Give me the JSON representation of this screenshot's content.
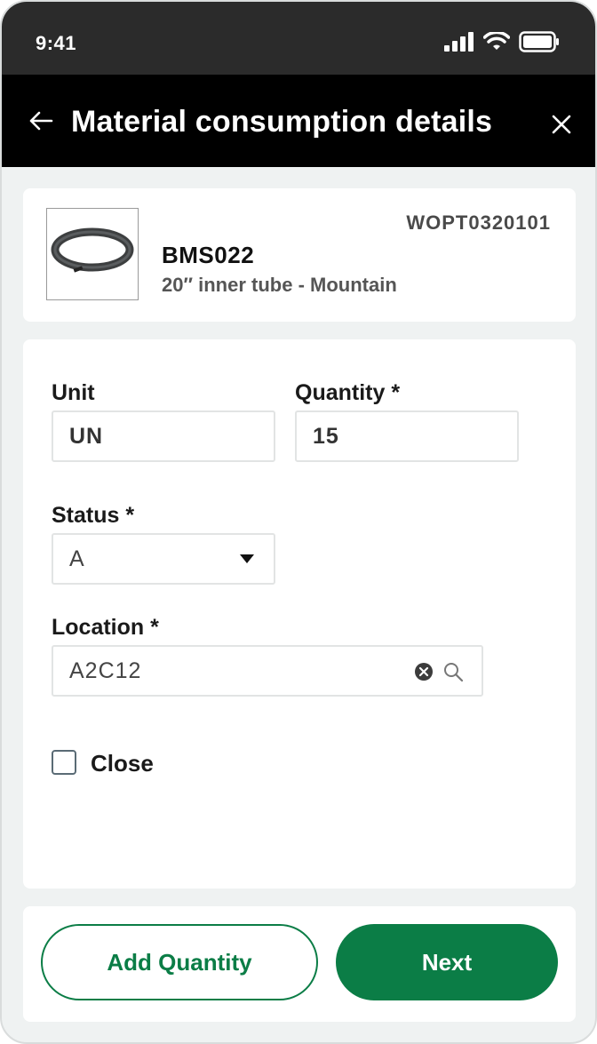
{
  "status_bar": {
    "time": "9:41"
  },
  "header": {
    "title": "Material consumption details"
  },
  "item": {
    "order_code": "WOPT0320101",
    "code": "BMS022",
    "description": "20″ inner tube - Mountain"
  },
  "form": {
    "unit": {
      "label": "Unit",
      "value": "UN"
    },
    "quantity": {
      "label": "Quantity *",
      "value": "15"
    },
    "status": {
      "label": "Status *",
      "value": "A"
    },
    "location": {
      "label": "Location *",
      "value": "A2C12"
    },
    "close_checkbox": {
      "label": "Close",
      "checked": false
    }
  },
  "footer": {
    "add_quantity_label": "Add Quantity",
    "next_label": "Next"
  },
  "colors": {
    "accent": "#0b7d46",
    "header_bg": "#000000",
    "status_bar_bg": "#2b2b2b",
    "page_bg": "#eff2f2"
  }
}
